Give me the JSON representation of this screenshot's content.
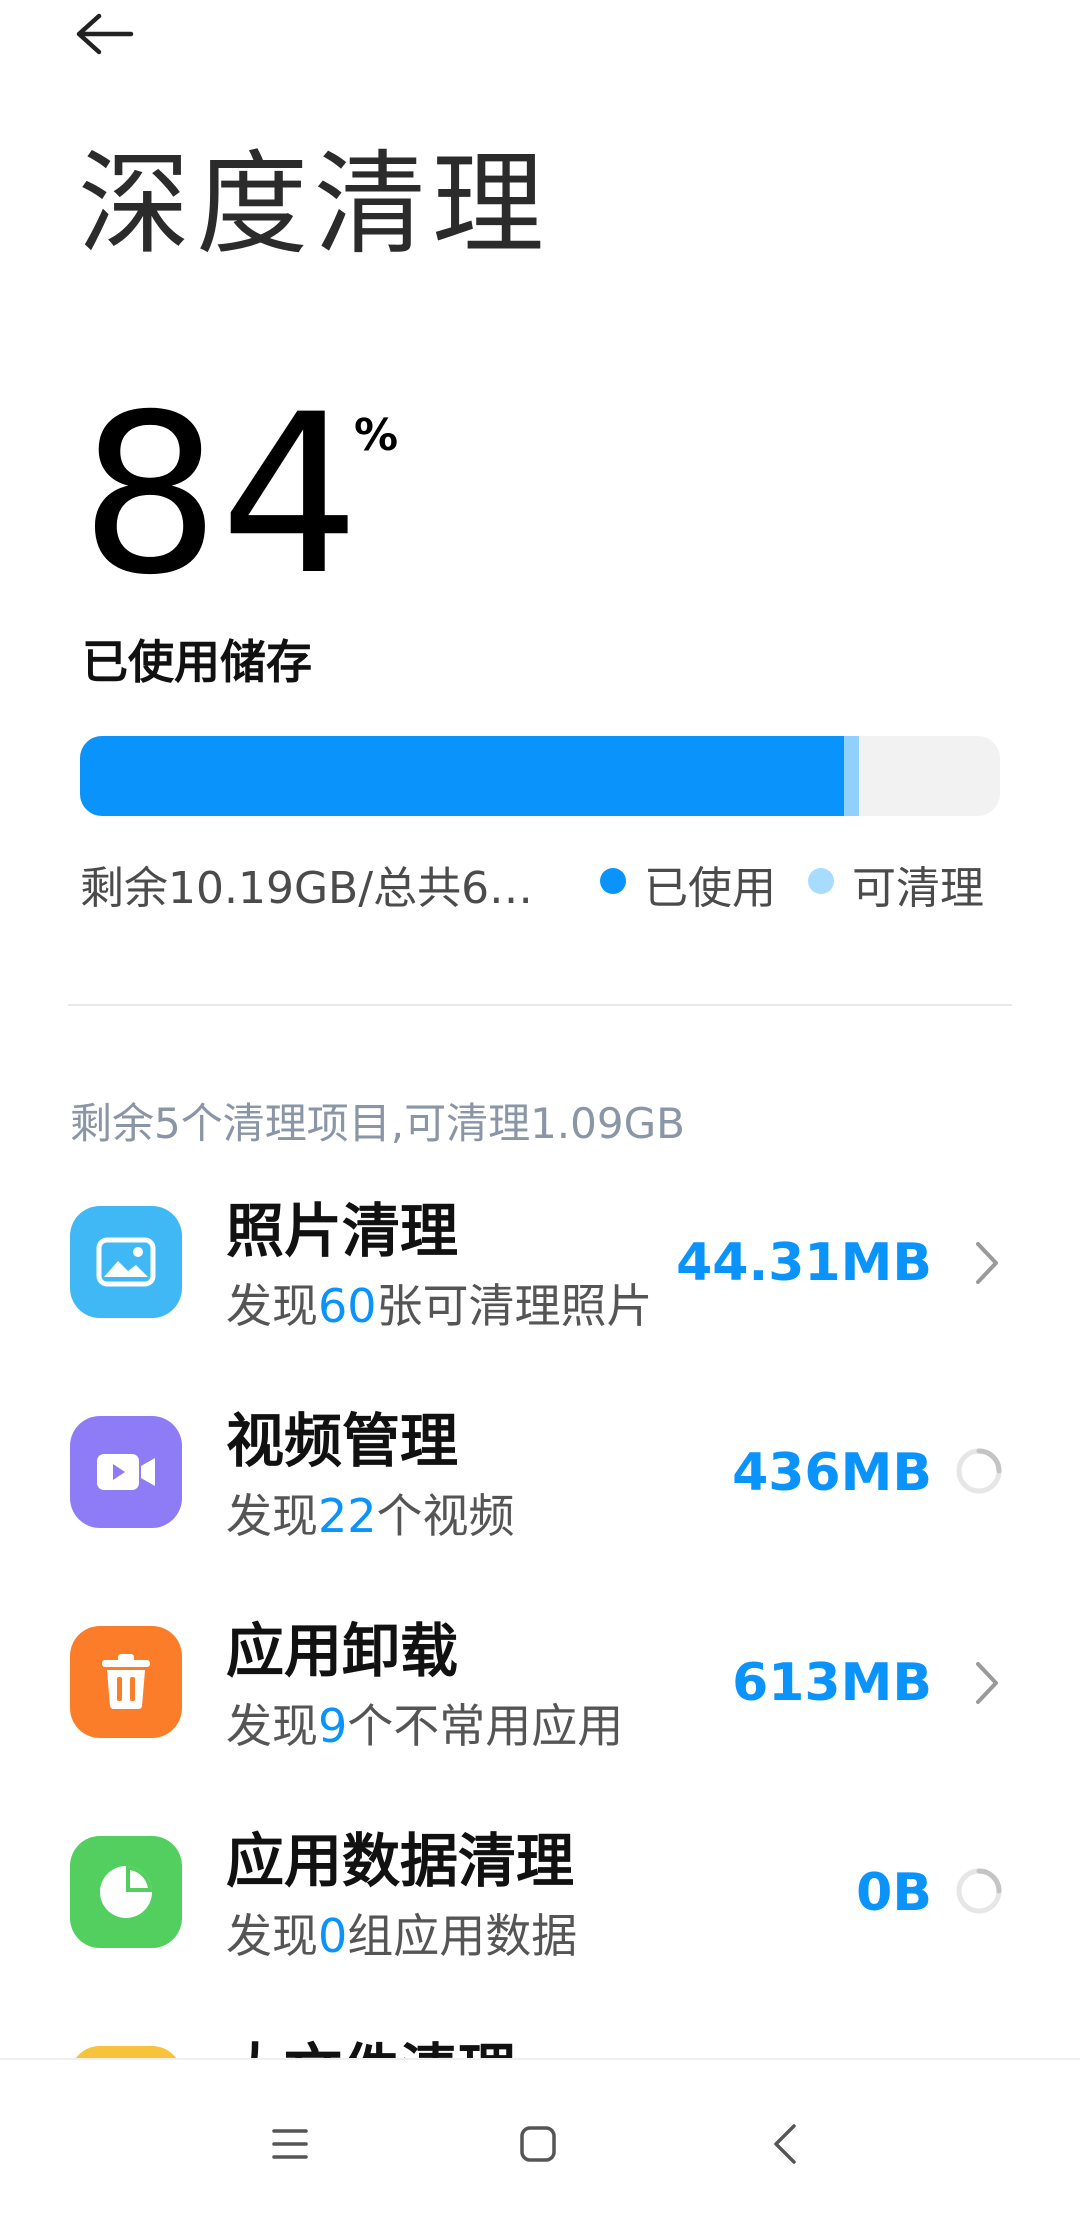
{
  "header": {
    "title": "深度清理"
  },
  "storage": {
    "percent_value": "84",
    "percent_sign": "%",
    "used_label": "已使用储存",
    "used_fraction": 0.83,
    "cleanable_fraction": 0.016,
    "remaining_text": "剩余10.19GB/总共6…",
    "legend_used": "已使用",
    "legend_cleanable": "可清理",
    "color_used": "#0a93fb",
    "color_cleanable": "#8fd0ff"
  },
  "summary": {
    "text": "剩余5个清理项目,可清理1.09GB"
  },
  "items": [
    {
      "title": "照片清理",
      "sub_prefix": "发现",
      "sub_count": "60",
      "sub_suffix": "张可清理照片",
      "size": "44.31MB",
      "icon": "image-icon",
      "color": "#3fb8f5",
      "status": "chevron"
    },
    {
      "title": "视频管理",
      "sub_prefix": "发现",
      "sub_count": "22",
      "sub_suffix": "个视频",
      "size": "436MB",
      "icon": "video-icon",
      "color": "#8d7cf6",
      "status": "loading"
    },
    {
      "title": "应用卸载",
      "sub_prefix": "发现",
      "sub_count": "9",
      "sub_suffix": "个不常用应用",
      "size": "613MB",
      "icon": "trash-icon",
      "color": "#fb7d2a",
      "status": "chevron"
    },
    {
      "title": "应用数据清理",
      "sub_prefix": "发现",
      "sub_count": "0",
      "sub_suffix": "组应用数据",
      "size": "0B",
      "icon": "pie-chart-icon",
      "color": "#52cf5e",
      "status": "loading"
    },
    {
      "title": "大文件清理",
      "icon": "folder-icon",
      "color": "#f7c33b"
    }
  ],
  "nav": {
    "icons": [
      "menu-icon",
      "home-icon",
      "back-icon"
    ]
  }
}
